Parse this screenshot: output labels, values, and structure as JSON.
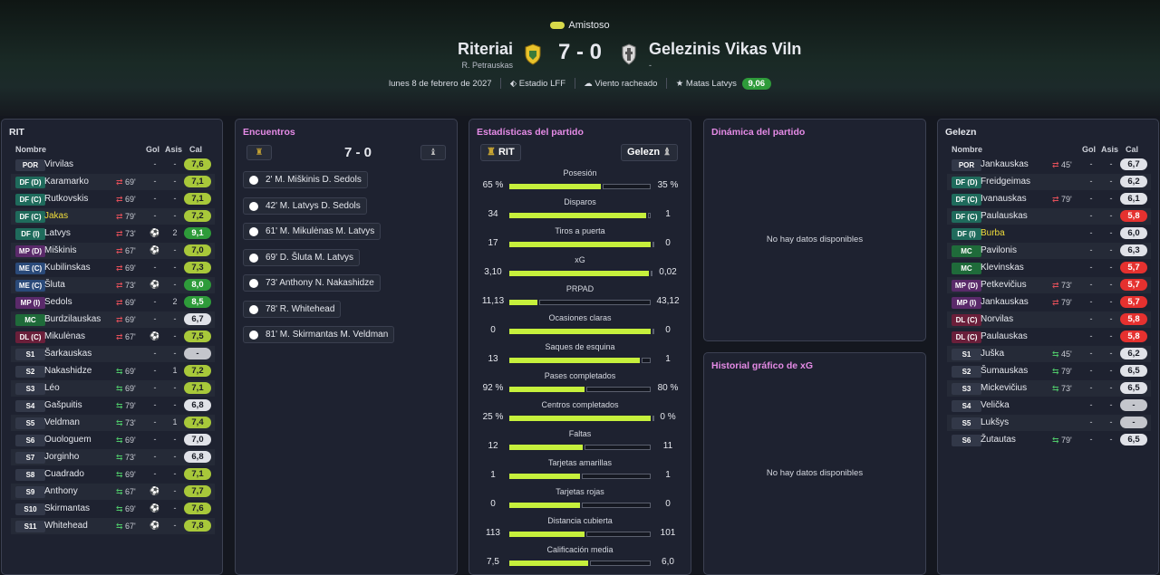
{
  "match": {
    "competition": "Amistoso",
    "home_team": "Riteriai",
    "away_team": "Gelezinis Vikas Viln",
    "home_coach": "R. Petrauskas",
    "away_coach": "-",
    "score": "7 - 0",
    "date": "lunes 8 de febrero de 2027",
    "stadium": "Estadio LFF",
    "weather": "Viento racheado",
    "motm_name": "Matas Latvys",
    "motm_rating": "9,06"
  },
  "home_panel": {
    "title": "RIT",
    "cols": {
      "name": "Nombre",
      "goals": "Gol",
      "assists": "Asis",
      "rating": "Cal"
    },
    "players": [
      {
        "pos": "POR",
        "name": "Virvilas",
        "sub": "",
        "subdir": "",
        "goals": "-",
        "assists": "-",
        "rating": "7,6",
        "rcol": "#a8c83a",
        "pcol": "#323848"
      },
      {
        "pos": "DF (D)",
        "name": "Karamarko",
        "sub": "69'",
        "subdir": "out",
        "goals": "-",
        "assists": "-",
        "rating": "7,1",
        "rcol": "#a8c83a",
        "pcol": "#1f6b5c"
      },
      {
        "pos": "DF (C)",
        "name": "Rutkovskis",
        "sub": "69'",
        "subdir": "out",
        "goals": "-",
        "assists": "-",
        "rating": "7,1",
        "rcol": "#a8c83a",
        "pcol": "#1f6b5c"
      },
      {
        "pos": "DF (C)",
        "name": "Jakas",
        "sub": "79'",
        "subdir": "out",
        "goals": "-",
        "assists": "-",
        "rating": "7,2",
        "rcol": "#a8c83a",
        "pcol": "#1f6b5c",
        "highlight": true
      },
      {
        "pos": "DF (I)",
        "name": "Latvys",
        "sub": "73'",
        "subdir": "out",
        "goals": "ball",
        "assists": "2",
        "rating": "9,1",
        "rcol": "#2e9b3a",
        "pcol": "#1f6b5c"
      },
      {
        "pos": "MP (D)",
        "name": "Miškinis",
        "sub": "67'",
        "subdir": "out",
        "goals": "ball",
        "assists": "-",
        "rating": "7,0",
        "rcol": "#a8c83a",
        "pcol": "#5a2a6a"
      },
      {
        "pos": "ME (C)",
        "name": "Kubilinskas",
        "sub": "69'",
        "subdir": "out",
        "goals": "-",
        "assists": "-",
        "rating": "7,3",
        "rcol": "#a8c83a",
        "pcol": "#2a4a7a"
      },
      {
        "pos": "ME (C)",
        "name": "Šluta",
        "sub": "73'",
        "subdir": "out",
        "goals": "ball",
        "assists": "-",
        "rating": "8,0",
        "rcol": "#2e9b3a",
        "pcol": "#2a4a7a"
      },
      {
        "pos": "MP (I)",
        "name": "Sedols",
        "sub": "69'",
        "subdir": "out",
        "goals": "-",
        "assists": "2",
        "rating": "8,5",
        "rcol": "#2e9b3a",
        "pcol": "#5a2a6a"
      },
      {
        "pos": "MC",
        "name": "Burdzilauskas",
        "sub": "69'",
        "subdir": "out",
        "goals": "-",
        "assists": "-",
        "rating": "6,7",
        "rcol": "#e0e2e8",
        "pcol": "#1f6b3a"
      },
      {
        "pos": "DL (C)",
        "name": "Mikulėnas",
        "sub": "67'",
        "subdir": "out",
        "goals": "ball",
        "assists": "-",
        "rating": "7,5",
        "rcol": "#a8c83a",
        "pcol": "#6a1f3a"
      },
      {
        "pos": "S1",
        "name": "Šarkauskas",
        "sub": "",
        "subdir": "",
        "goals": "-",
        "assists": "-",
        "rating": "-",
        "rcol": "#c4c6cc",
        "pcol": "#323848"
      },
      {
        "pos": "S2",
        "name": "Nakashidze",
        "sub": "69'",
        "subdir": "in",
        "goals": "-",
        "assists": "1",
        "rating": "7,2",
        "rcol": "#a8c83a",
        "pcol": "#323848"
      },
      {
        "pos": "S3",
        "name": "Léo",
        "sub": "69'",
        "subdir": "in",
        "goals": "-",
        "assists": "-",
        "rating": "7,1",
        "rcol": "#a8c83a",
        "pcol": "#323848"
      },
      {
        "pos": "S4",
        "name": "Gašpuitis",
        "sub": "79'",
        "subdir": "in",
        "goals": "-",
        "assists": "-",
        "rating": "6,8",
        "rcol": "#e0e2e8",
        "pcol": "#323848"
      },
      {
        "pos": "S5",
        "name": "Veldman",
        "sub": "73'",
        "subdir": "in",
        "goals": "-",
        "assists": "1",
        "rating": "7,4",
        "rcol": "#a8c83a",
        "pcol": "#323848"
      },
      {
        "pos": "S6",
        "name": "Ouologuem",
        "sub": "69'",
        "subdir": "in",
        "goals": "-",
        "assists": "-",
        "rating": "7,0",
        "rcol": "#e0e2e8",
        "pcol": "#323848"
      },
      {
        "pos": "S7",
        "name": "Jorginho",
        "sub": "73'",
        "subdir": "in",
        "goals": "-",
        "assists": "-",
        "rating": "6,8",
        "rcol": "#e0e2e8",
        "pcol": "#323848"
      },
      {
        "pos": "S8",
        "name": "Cuadrado",
        "sub": "69'",
        "subdir": "in",
        "goals": "-",
        "assists": "-",
        "rating": "7,1",
        "rcol": "#a8c83a",
        "pcol": "#323848"
      },
      {
        "pos": "S9",
        "name": "Anthony",
        "sub": "67'",
        "subdir": "in",
        "goals": "ball",
        "assists": "-",
        "rating": "7,7",
        "rcol": "#a8c83a",
        "pcol": "#323848"
      },
      {
        "pos": "S10",
        "name": "Skirmantas",
        "sub": "69'",
        "subdir": "in",
        "goals": "ball",
        "assists": "-",
        "rating": "7,6",
        "rcol": "#a8c83a",
        "pcol": "#323848"
      },
      {
        "pos": "S11",
        "name": "Whitehead",
        "sub": "67'",
        "subdir": "in",
        "goals": "ball",
        "assists": "-",
        "rating": "7,8",
        "rcol": "#a8c83a",
        "pcol": "#323848"
      }
    ]
  },
  "away_panel": {
    "title": "Gelezn",
    "cols": {
      "name": "Nombre",
      "goals": "Gol",
      "assists": "Asis",
      "rating": "Cal"
    },
    "players": [
      {
        "pos": "POR",
        "name": "Jankauskas",
        "sub": "45'",
        "subdir": "out",
        "goals": "-",
        "assists": "-",
        "rating": "6,7",
        "rcol": "#e0e2e8",
        "pcol": "#323848"
      },
      {
        "pos": "DF (D)",
        "name": "Freidgeimas",
        "sub": "",
        "subdir": "",
        "goals": "-",
        "assists": "-",
        "rating": "6,2",
        "rcol": "#e0e2e8",
        "pcol": "#1f6b5c"
      },
      {
        "pos": "DF (C)",
        "name": "Ivanauskas",
        "sub": "79'",
        "subdir": "out",
        "goals": "-",
        "assists": "-",
        "rating": "6,1",
        "rcol": "#e0e2e8",
        "pcol": "#1f6b5c"
      },
      {
        "pos": "DF (C)",
        "name": "Paulauskas",
        "sub": "",
        "subdir": "",
        "goals": "-",
        "assists": "-",
        "rating": "5,8",
        "rcol": "#e5312f",
        "pcol": "#1f6b5c"
      },
      {
        "pos": "DF (I)",
        "name": "Burba",
        "sub": "",
        "subdir": "",
        "goals": "-",
        "assists": "-",
        "rating": "6,0",
        "rcol": "#e0e2e8",
        "pcol": "#1f6b5c",
        "highlight": true
      },
      {
        "pos": "MC",
        "name": "Pavilonis",
        "sub": "",
        "subdir": "",
        "goals": "-",
        "assists": "-",
        "rating": "6,3",
        "rcol": "#e0e2e8",
        "pcol": "#1f6b3a"
      },
      {
        "pos": "MC",
        "name": "Klevinskas",
        "sub": "",
        "subdir": "",
        "goals": "-",
        "assists": "-",
        "rating": "5,7",
        "rcol": "#e5312f",
        "pcol": "#1f6b3a"
      },
      {
        "pos": "MP (D)",
        "name": "Petkevičius",
        "sub": "73'",
        "subdir": "out",
        "goals": "-",
        "assists": "-",
        "rating": "5,7",
        "rcol": "#e5312f",
        "pcol": "#5a2a6a"
      },
      {
        "pos": "MP (I)",
        "name": "Jankauskas",
        "sub": "79'",
        "subdir": "out",
        "goals": "-",
        "assists": "-",
        "rating": "5,7",
        "rcol": "#e5312f",
        "pcol": "#5a2a6a"
      },
      {
        "pos": "DL (C)",
        "name": "Norvilas",
        "sub": "",
        "subdir": "",
        "goals": "-",
        "assists": "-",
        "rating": "5,8",
        "rcol": "#e5312f",
        "pcol": "#6a1f3a"
      },
      {
        "pos": "DL (C)",
        "name": "Paulauskas",
        "sub": "",
        "subdir": "",
        "goals": "-",
        "assists": "-",
        "rating": "5,8",
        "rcol": "#e5312f",
        "pcol": "#6a1f3a"
      },
      {
        "pos": "S1",
        "name": "Juška",
        "sub": "45'",
        "subdir": "in",
        "goals": "-",
        "assists": "-",
        "rating": "6,2",
        "rcol": "#e0e2e8",
        "pcol": "#323848"
      },
      {
        "pos": "S2",
        "name": "Šumauskas",
        "sub": "79'",
        "subdir": "in",
        "goals": "-",
        "assists": "-",
        "rating": "6,5",
        "rcol": "#e0e2e8",
        "pcol": "#323848"
      },
      {
        "pos": "S3",
        "name": "Mickevičius",
        "sub": "73'",
        "subdir": "in",
        "goals": "-",
        "assists": "-",
        "rating": "6,5",
        "rcol": "#e0e2e8",
        "pcol": "#323848"
      },
      {
        "pos": "S4",
        "name": "Velička",
        "sub": "",
        "subdir": "",
        "goals": "-",
        "assists": "-",
        "rating": "-",
        "rcol": "#c4c6cc",
        "pcol": "#323848"
      },
      {
        "pos": "S5",
        "name": "Lukšys",
        "sub": "",
        "subdir": "",
        "goals": "-",
        "assists": "-",
        "rating": "-",
        "rcol": "#c4c6cc",
        "pcol": "#323848"
      },
      {
        "pos": "S6",
        "name": "Žutautas",
        "sub": "79'",
        "subdir": "in",
        "goals": "-",
        "assists": "-",
        "rating": "6,5",
        "rcol": "#e0e2e8",
        "pcol": "#323848"
      }
    ]
  },
  "events_panel": {
    "title": "Encuentros",
    "score": "7 - 0",
    "events": [
      "2' M. Miškinis D. Sedols",
      "42' M. Latvys D. Sedols",
      "61' M. Mikulėnas M. Latvys",
      "69' D. Šluta M. Latvys",
      "73' Anthony N. Nakashidze",
      "78' R. Whitehead",
      "81' M. Skirmantas M. Veldman"
    ]
  },
  "stats_panel": {
    "title": "Estadísticas del partido",
    "home_tag": "RIT",
    "away_tag": "Gelezn",
    "stats": [
      {
        "label": "Posesión",
        "home": "65 %",
        "away": "35 %",
        "hp": 0.65,
        "ap": 0.35
      },
      {
        "label": "Disparos",
        "home": "34",
        "away": "1",
        "hp": 0.97,
        "ap": 0.03
      },
      {
        "label": "Tiros a puerta",
        "home": "17",
        "away": "0",
        "hp": 1.0,
        "ap": 0.0
      },
      {
        "label": "xG",
        "home": "3,10",
        "away": "0,02",
        "hp": 0.99,
        "ap": 0.01
      },
      {
        "label": "PRPAD",
        "home": "11,13",
        "away": "43,12",
        "hp": 0.2,
        "ap": 0.8
      },
      {
        "label": "Ocasiones claras",
        "home": "0",
        "away": "0",
        "hp": 1.0,
        "ap": 0.0
      },
      {
        "label": "Saques de esquina",
        "home": "13",
        "away": "1",
        "hp": 0.92,
        "ap": 0.08
      },
      {
        "label": "Pases completados",
        "home": "92 %",
        "away": "80 %",
        "hp": 0.53,
        "ap": 0.47
      },
      {
        "label": "Centros completados",
        "home": "25 %",
        "away": "0 %",
        "hp": 1.0,
        "ap": 0.0
      },
      {
        "label": "Faltas",
        "home": "12",
        "away": "11",
        "hp": 0.52,
        "ap": 0.48
      },
      {
        "label": "Tarjetas amarillas",
        "home": "1",
        "away": "1",
        "hp": 0.5,
        "ap": 0.5
      },
      {
        "label": "Tarjetas rojas",
        "home": "0",
        "away": "0",
        "hp": 0.5,
        "ap": 0.5
      },
      {
        "label": "Distancia cubierta",
        "home": "113",
        "away": "101",
        "hp": 0.53,
        "ap": 0.47
      },
      {
        "label": "Calificación media",
        "home": "7,5",
        "away": "6,0",
        "hp": 0.56,
        "ap": 0.44
      }
    ]
  },
  "dynamics_panel": {
    "title": "Dinámica del partido",
    "empty": "No hay datos disponibles"
  },
  "xg_panel": {
    "title": "Historial gráfico de xG",
    "empty": "No hay datos disponibles"
  }
}
